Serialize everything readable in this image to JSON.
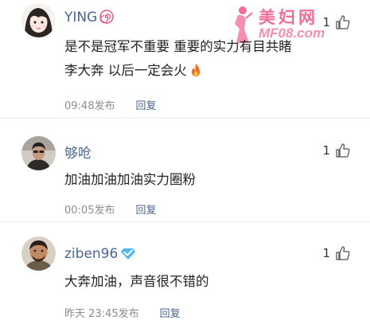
{
  "comments": [
    {
      "username": "YING",
      "badge_icon": "spiral-badge-icon",
      "text_line1": "是不是冠军不重要  重要的实力有目共睹",
      "text_line2": "李大奔 以后一定会火",
      "emoji_icon": "fire-icon",
      "time": "09:48发布",
      "reply_label": "回复",
      "likes": "1"
    },
    {
      "username": "够呛",
      "text_line1": "加油加油加油实力圈粉",
      "time": "00:05发布",
      "reply_label": "回复",
      "likes": "1"
    },
    {
      "username": "ziben96",
      "badge_icon": "verified-diamond-icon",
      "text_line1": "大奔加油，声音很不错的",
      "time": "昨天 23:45发布",
      "reply_label": "回复",
      "likes": "1"
    }
  ],
  "watermark": {
    "title": "美妇网",
    "url": "MF08.com"
  },
  "colors": {
    "username": "#4a6591",
    "meta": "#8c8c8c",
    "watermark": "#f06e98"
  }
}
